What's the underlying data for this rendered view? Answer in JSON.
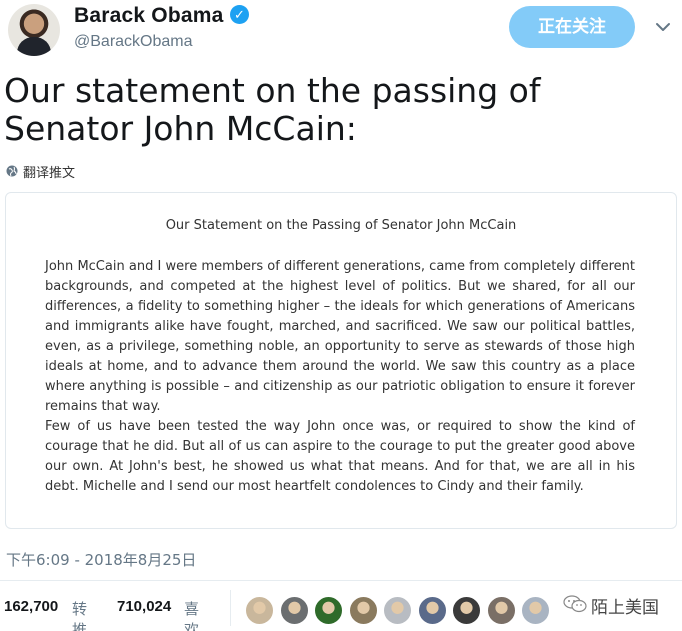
{
  "header": {
    "name": "Barack Obama",
    "handle": "@BarackObama",
    "follow_label": "正在关注"
  },
  "tweet": {
    "text": "Our statement on the passing of Senator John McCain:",
    "translate_label": "翻译推文"
  },
  "card": {
    "title": "Our Statement on the Passing of Senator John McCain",
    "paragraphs": [
      "John McCain and I were members of different generations, came from completely different backgrounds, and competed at the highest level of politics. But we shared, for all our differences, a fidelity to something higher – the ideals for which generations of Americans and immigrants alike have fought, marched, and sacrificed. We saw our political battles, even, as a privilege, something noble, an opportunity to serve as stewards of those high ideals at home, and to advance them around the world. We saw this country as a place where anything is possible – and citizenship as our patriotic obligation to ensure it forever remains that way.",
      "Few of us have been tested the way John once was, or required to show the kind of courage that he did. But all of us can aspire to the courage to put the greater good above our own. At John's best, he showed us what that means. And for that, we are all in his debt. Michelle and I send our most heartfelt condolences to Cindy and their family."
    ]
  },
  "meta": {
    "timestamp": "下午6:09 - 2018年8月25日"
  },
  "stats": {
    "retweets": "162,700",
    "retweets_label": "转推",
    "likes": "710,024",
    "likes_label": "喜欢"
  },
  "likers": [
    {
      "icon": "liker-avatar",
      "color": "#c9b79c"
    },
    {
      "icon": "liker-avatar",
      "color": "#6b6e70"
    },
    {
      "icon": "liker-avatar",
      "color": "#2f6b2a"
    },
    {
      "icon": "liker-avatar",
      "color": "#8a7a5e"
    },
    {
      "icon": "liker-avatar",
      "color": "#b8bcc2"
    },
    {
      "icon": "liker-avatar",
      "color": "#5a6a8a"
    },
    {
      "icon": "liker-avatar",
      "color": "#3a3a3a"
    },
    {
      "icon": "liker-avatar",
      "color": "#7a6f66"
    },
    {
      "icon": "liker-avatar",
      "color": "#a9b4c2"
    }
  ],
  "watermark": {
    "text": "陌上美国"
  },
  "colors": {
    "accent": "#1da1f2",
    "text": "#14171a",
    "muted": "#657786"
  }
}
